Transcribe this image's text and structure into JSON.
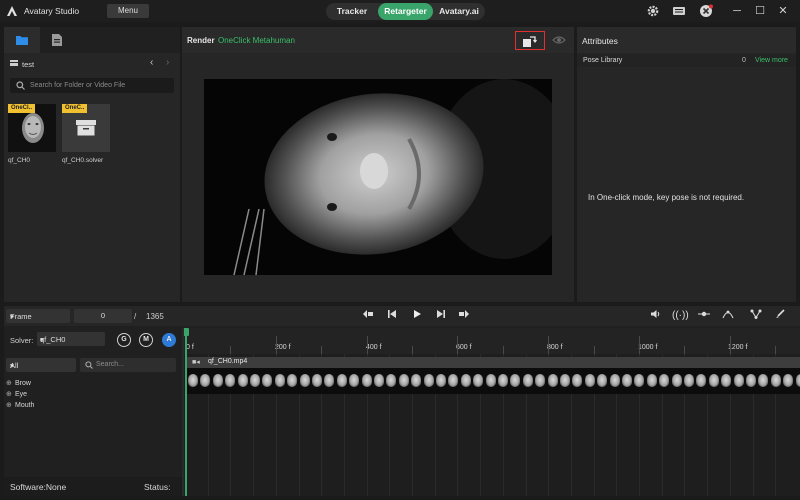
{
  "app": {
    "title": "Avatary Studio",
    "menu_label": "Menu"
  },
  "mode_tabs": [
    {
      "label": "Tracker",
      "active": false
    },
    {
      "label": "Retargeter",
      "active": true
    },
    {
      "label": "Avatary.ai",
      "active": false
    }
  ],
  "colors": {
    "accent": "#3aa56b",
    "badge": "#f0c030",
    "highlight": "#e03030"
  },
  "left_panel": {
    "folder_name": "test",
    "search_placeholder": "Search for Folder or Video File",
    "assets": [
      {
        "badge": "OneCl..",
        "name": "qf_CH0",
        "icon": "face-thumbnail"
      },
      {
        "badge": "OneC..",
        "name": "qf_CH0.solver",
        "icon": "solver-box-icon"
      }
    ]
  },
  "render": {
    "title": "Render",
    "mode": "OneClick Metahuman"
  },
  "attributes": {
    "title": "Attributes",
    "pose_library": {
      "label": "Pose Library",
      "count": "0",
      "link": "View more"
    },
    "message": "In One-click mode, key pose is not required."
  },
  "timeline": {
    "frame_mode": "Frame",
    "current_frame": "0",
    "separator": "/",
    "total_frames": "1365",
    "solver_label": "Solver:",
    "solver_value": "qf_CH0",
    "mode_buttons": [
      "G",
      "M",
      "A"
    ],
    "filter_value": "All",
    "search_placeholder": "Search...",
    "curve_groups": [
      "Brow",
      "Eye",
      "Mouth"
    ],
    "ruler_labels": [
      "0 f",
      "200 f",
      "400 f",
      "600 f",
      "800 f",
      "1000 f",
      "1200 f"
    ],
    "clip_name": "qf_CH0.mp4"
  },
  "status": {
    "software": "Software:None",
    "status": "Status:"
  }
}
